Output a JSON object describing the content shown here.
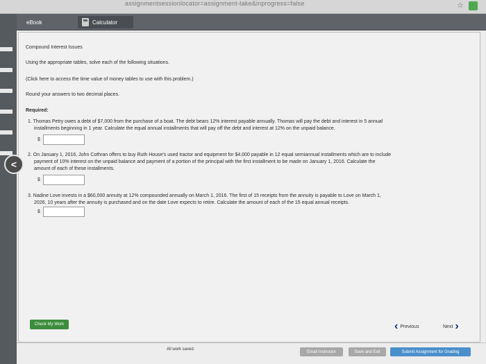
{
  "browser": {
    "url_fragment": "assignmentsessionlocator=assignment-take&inprogress=false"
  },
  "tabs": [
    {
      "label": "eBook"
    },
    {
      "label": "Calculator"
    }
  ],
  "problem": {
    "title": "Compound Interest Issues",
    "instructions": "Using the appropriate tables, solve each of the following situations.",
    "tables_link": "(Click here to access the time value of money tables to use with this problem.)",
    "rounding": "Round your answers to two decimal places.",
    "required_label": "Required:",
    "currency_symbol": "$",
    "items": [
      {
        "line1": "1. Thomas Petry owes a debt of $7,000 from the purchase of a boat. The debt bears 12% interest payable annually. Thomas will pay the debt and interest in 5 annual",
        "line2": "installments beginning in 1 year. Calculate the equal annual installments that will pay off the debt and interest at 12% on the unpaid balance.",
        "line3": "",
        "answer": ""
      },
      {
        "line1": "2. On January 1, 2016, John Cothran offers to buy Ruth House's used tractor and equipment for $4,000 payable in 12 equal semiannual installments which are to include",
        "line2": "payment of 10% interest on the unpaid balance and payment of a portion of the principal with the first installment to be made on January 1, 2016. Calculate the",
        "line3": "amount of each of these installments.",
        "answer": ""
      },
      {
        "line1": "3. Nadine Love invests in a $60,000 annuity at 12% compounded annually on March 1, 2016. The first of 15 receipts from the annuity is payable to Love on March 1,",
        "line2": "2026, 10 years after the annuity is purchased and on the date Love expects to retire. Calculate the amount of each of the 15 equal annual receipts.",
        "line3": "",
        "answer": ""
      }
    ]
  },
  "nav": {
    "back_glyph": "<",
    "check_label": "Check My Work",
    "previous_label": "Previous",
    "next_label": "Next"
  },
  "footer": {
    "status": "All work saved.",
    "email_label": "Email Instructor",
    "save_label": "Save and Exit",
    "submit_label": "Submit Assignment for Grading"
  }
}
